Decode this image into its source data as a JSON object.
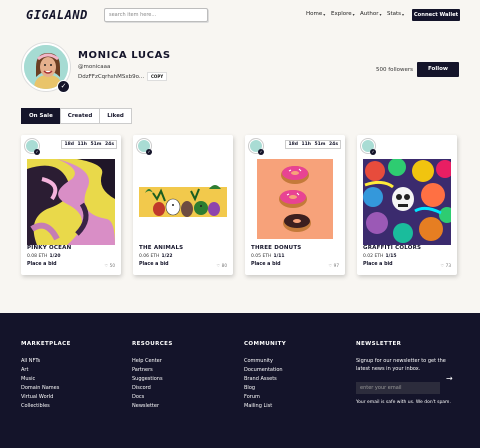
{
  "header": {
    "logo": "GIGALAND",
    "search_placeholder": "search item here...",
    "nav": [
      {
        "label": "Home"
      },
      {
        "label": "Explore"
      },
      {
        "label": "Author"
      },
      {
        "label": "Stats"
      }
    ],
    "connect_label": "Connect Wallet"
  },
  "profile": {
    "name": "MONICA LUCAS",
    "handle": "@monicaaa",
    "wallet": "DdzFFzCqrhshMSxb9o...",
    "copy_label": "COPY",
    "followers": "500 followers",
    "follow_label": "Follow"
  },
  "tabs": [
    {
      "label": "On Sale",
      "active": true
    },
    {
      "label": "Created",
      "active": false
    },
    {
      "label": "Liked",
      "active": false
    }
  ],
  "cards": [
    {
      "title": "PINKY OCEAN",
      "price": "0.08 ETH",
      "edition": "1/20",
      "bid": "Place a bid",
      "likes": "50",
      "timer": "18d 11h 51m 24s",
      "art": "pinky"
    },
    {
      "title": "THE ANIMALS",
      "price": "0.06 ETH",
      "edition": "1/22",
      "bid": "Place a bid",
      "likes": "80",
      "timer": "",
      "art": "animals"
    },
    {
      "title": "THREE DONUTS",
      "price": "0.05 ETH",
      "edition": "1/11",
      "bid": "Place a bid",
      "likes": "97",
      "timer": "18d 11h 51m 24s",
      "art": "donuts"
    },
    {
      "title": "GRAFFITI COLORS",
      "price": "0.02 ETH",
      "edition": "1/15",
      "bid": "Place a bid",
      "likes": "73",
      "timer": "",
      "art": "graffiti"
    }
  ],
  "footer": {
    "columns": [
      {
        "heading": "MARKETPLACE",
        "links": [
          "All NFTs",
          "Art",
          "Music",
          "Domain Names",
          "Virtual World",
          "Collectibles"
        ]
      },
      {
        "heading": "RESOURCES",
        "links": [
          "Help Center",
          "Partners",
          "Suggestions",
          "Discord",
          "Docs",
          "Newsletter"
        ]
      },
      {
        "heading": "COMMUNITY",
        "links": [
          "Community",
          "Documentation",
          "Brand Assets",
          "Blog",
          "Forum",
          "Mailing List"
        ]
      }
    ],
    "newsletter": {
      "heading": "NEWSLETTER",
      "text": "Signup for our newsletter to get the latest news in your inbox.",
      "placeholder": "enter your email",
      "safe_text": "Your email is safe with us. We don't spam."
    }
  },
  "colors": {
    "primary": "#14142a",
    "background": "#f8f6f2"
  }
}
